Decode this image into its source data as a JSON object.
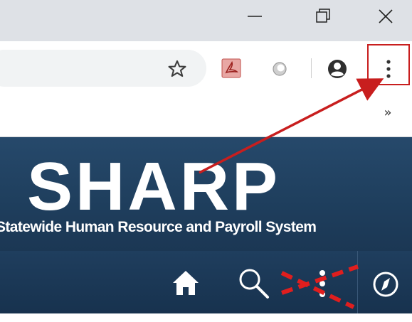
{
  "window_controls": {
    "minimize_icon": "minimize-icon",
    "maximize_icon": "restore-icon",
    "close_icon": "close-icon"
  },
  "toolbar": {
    "bookmark_star_icon": "star-icon",
    "pdf_extension_icon": "acrobat-icon",
    "extension_icon": "circle-extension-icon",
    "profile_icon": "account-icon",
    "menu_icon": "kebab-menu-icon"
  },
  "bookmarks_bar": {
    "overflow_label": "»"
  },
  "site": {
    "logo_text": "SHARP",
    "subtitle": "Statewide Human Resource and Payroll System"
  },
  "nav": {
    "home_icon": "home-icon",
    "search_icon": "search-icon",
    "menu_icon": "kebab-menu-icon",
    "compass_icon": "compass-icon"
  },
  "annotation": {
    "color": "#c81e1e",
    "arrow_label": "points to browser menu",
    "cross_out": "red dashed X over site menu icon"
  }
}
